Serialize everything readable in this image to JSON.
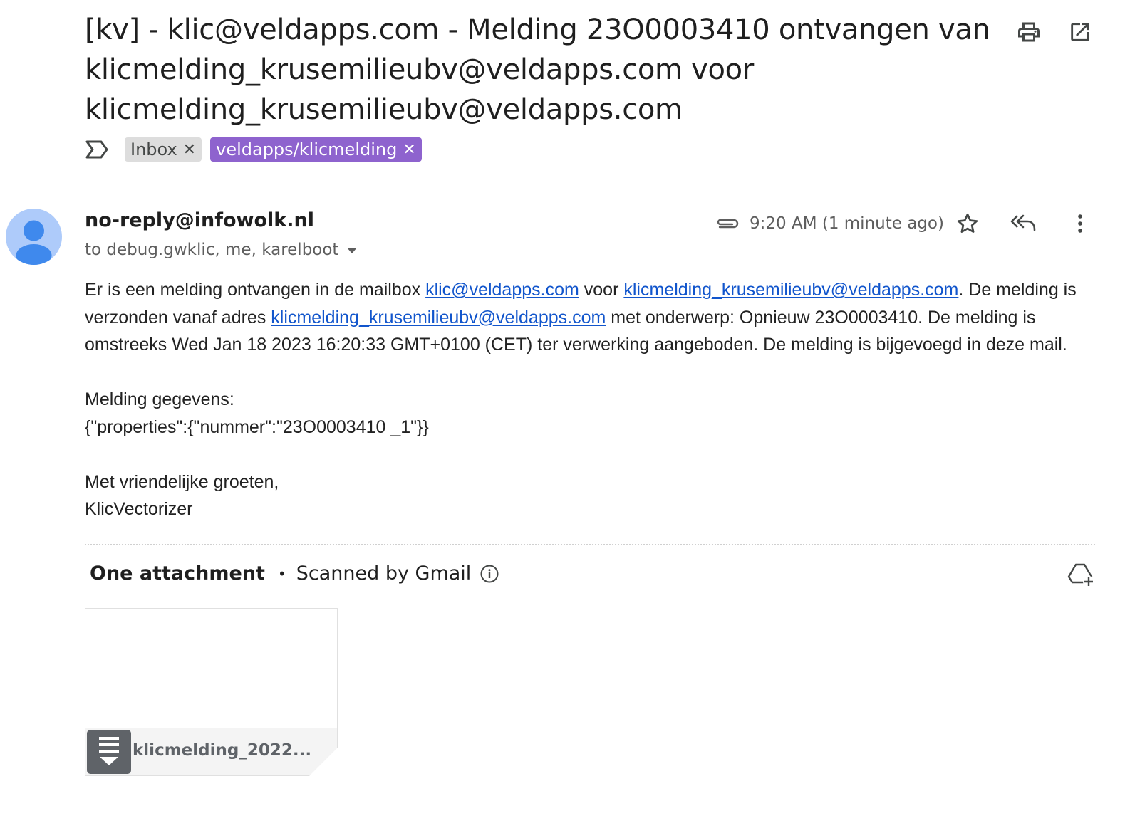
{
  "subject": {
    "line1": "[kv] - klic@veldapps.com - Melding 23O0003410 ontvangen van",
    "line2": "klicmelding_krusemilieubv@veldapps.com voor",
    "line3": "klicmelding_krusemilieubv@veldapps.com"
  },
  "toolbar": {
    "print_icon": "print-icon",
    "open_new_window_icon": "open-in-new-icon"
  },
  "labels": [
    {
      "name": "Inbox",
      "color": "#dddddd"
    },
    {
      "name": "veldapps/klicmelding",
      "color": "#8e63ce"
    }
  ],
  "message": {
    "sender": "no-reply@infowolk.nl",
    "recipients": "to debug.gwklic, me, karelboot",
    "time": "9:20 AM (1 minute ago)",
    "body": {
      "p1_a": "Er is een melding ontvangen in de mailbox ",
      "link1": "klic@veldapps.com",
      "p1_b": " voor ",
      "link2": "klicmelding_krusemilieubv@veldapps.com",
      "p1_c": ". De melding is verzonden vanaf adres ",
      "link3": "klicmelding_krusemilieubv@veldapps.com",
      "p1_d": " met onderwerp: Opnieuw 23O0003410. De melding is omstreeks Wed Jan 18 2023 16:20:33 GMT+0100 (CET) ter verwerking aangeboden. De melding is bijgevoegd in deze mail.",
      "p2_l1": "Melding gegevens:",
      "p2_l2": "{\"properties\":{\"nummer\":\"23O0003410 _1\"}}",
      "p3_l1": "Met vriendelijke groeten,",
      "p3_l2": "KlicVectorizer"
    }
  },
  "attachments": {
    "heading": "One attachment",
    "scanned": "Scanned by Gmail",
    "file_name": "klicmelding_2022..."
  }
}
